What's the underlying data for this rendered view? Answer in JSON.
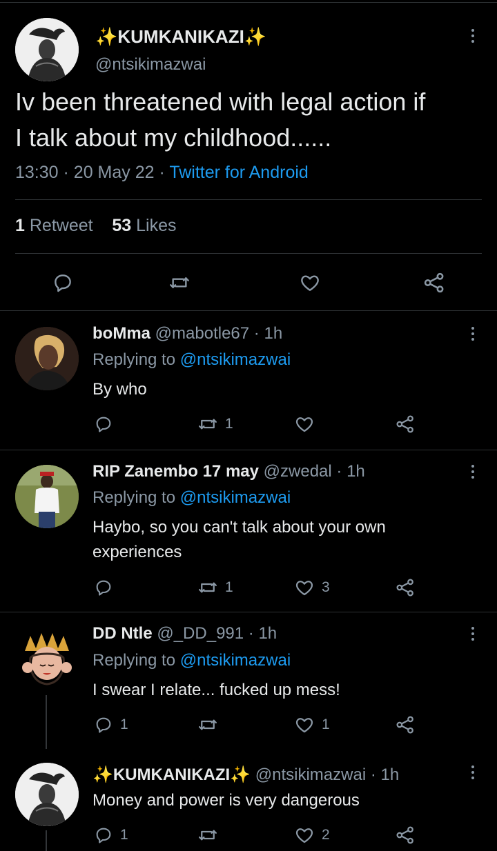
{
  "main_tweet": {
    "display_name": "✨KUMKANIKAZI✨",
    "handle": "@ntsikimazwai",
    "text_line1": "Iv been threatened with legal action if",
    "text_line2": "I talk about my childhood......",
    "time": "13:30",
    "date": "20 May 22",
    "separator": "·",
    "client": "Twitter for Android",
    "retweet_count": "1",
    "retweet_label": "Retweet",
    "like_count": "53",
    "like_label": "Likes"
  },
  "replying_label": "Replying to",
  "replies": [
    {
      "display_name": "boMma",
      "handle": "@mabotle67",
      "time": "1h",
      "replying_to": "@ntsikimazwai",
      "text_line1": "By who",
      "text_line2": "",
      "reply_count": "",
      "retweet_count": "1",
      "like_count": ""
    },
    {
      "display_name": "RIP Zanembo 17 may",
      "handle": "@zwedal",
      "time": "1h",
      "replying_to": "@ntsikimazwai",
      "text_line1": "Haybo, so you can't talk about your own",
      "text_line2": "experiences",
      "reply_count": "",
      "retweet_count": "1",
      "like_count": "3"
    },
    {
      "display_name": "DD Ntle",
      "handle": "@_DD_991",
      "time": "1h",
      "replying_to": "@ntsikimazwai",
      "text_line1": "I swear I relate... fucked up mess!",
      "text_line2": "",
      "reply_count": "1",
      "retweet_count": "",
      "like_count": "1"
    },
    {
      "display_name": "✨KUMKANIKAZI✨",
      "handle": "@ntsikimazwai",
      "time": "1h",
      "replying_to": "",
      "text_line1": "Money and power is very dangerous",
      "text_line2": "",
      "reply_count": "1",
      "retweet_count": "",
      "like_count": "2"
    }
  ],
  "colors": {
    "background": "#000000",
    "text": "#e7e9ea",
    "muted": "#8b98a5",
    "link": "#1d9bf0",
    "divider": "#2f3336"
  },
  "icons": [
    "more-options-icon",
    "reply-icon",
    "retweet-icon",
    "like-icon",
    "share-icon"
  ]
}
